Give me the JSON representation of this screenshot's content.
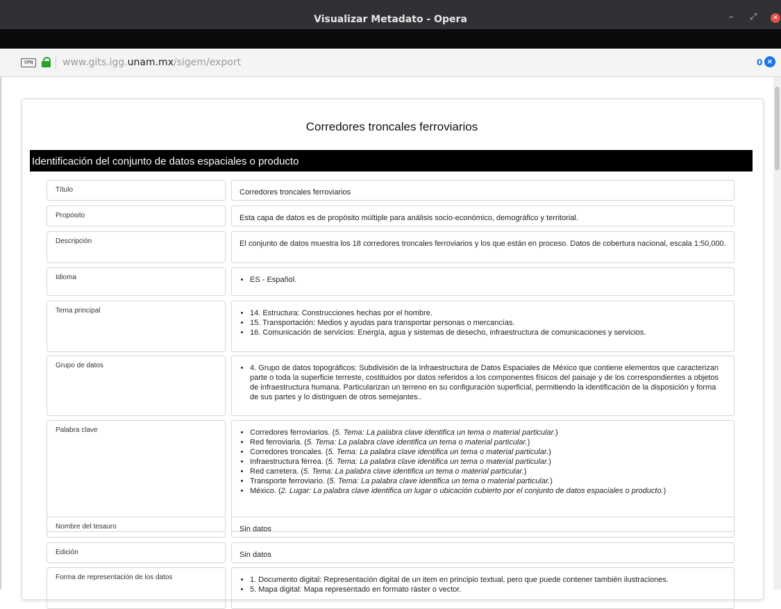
{
  "window": {
    "title": "Visualizar Metadato - Opera",
    "minimize": "–",
    "restore": "⤢",
    "close": "×"
  },
  "addressbar": {
    "vpn_label": "VPN",
    "url_prefix": "www.gits.igg.",
    "url_domain": "unam.mx",
    "url_path": "/sigem/export",
    "counter": "0",
    "badge_symbol": "×"
  },
  "document": {
    "title": "Corredores troncales ferroviarios",
    "section_title": "Identificación del conjunto de datos espaciales o producto",
    "rows": [
      {
        "label": "Título",
        "text": "Corredores troncales ferroviarios"
      },
      {
        "label": "Propósito",
        "text": "Esta capa de datos es de propósito múltiple para análisis socio-económico, demográfico y territorial."
      },
      {
        "label": "Descripción",
        "text": "El conjunto de datos muestra los 18 corredores troncales ferroviarios y los que están en proceso. Datos de cobertura nacional, escala 1:50,000."
      },
      {
        "label": "Idioma",
        "items": [
          "ES - Español."
        ]
      },
      {
        "label": "Tema principal",
        "items": [
          "14. Estructura: Construcciones hechas por el hombre.",
          "15. Transportación: Medios y ayudas para transportar personas o mercancías.",
          "16. Comunicación de servicios: Energía, agua y sistemas de desecho, infraestructura de comunicaciones y servicios."
        ]
      },
      {
        "label": "Grupo de datos",
        "items": [
          "4. Grupo de datos topográficos: Subdivisión de la Infraestructura de Datos Espaciales de México que contiene elementos que caracterizan parte o toda la superficie terreste, costituidos por datos referidos a los componentes físicos del paisaje y de los correspondientes a objetos de infraestructura humana. Particularizan un terreno en su configuración superficial, permitiendo la identificación de la disposición y forma de sus partes y lo distinguen de otros semejantes.."
        ]
      },
      {
        "label": "Palabra clave",
        "keywords": [
          {
            "term": "Corredores ferroviarios.",
            "note": "5. Tema: La palabra clave identifica un tema o material particular."
          },
          {
            "term": "Red ferroviaria.",
            "note": "5. Tema: La palabra clave identifica un tema o material particular."
          },
          {
            "term": "Corredores troncales.",
            "note": "5. Tema: La palabra clave identifica un tema o material particular."
          },
          {
            "term": "Infraestructura férrea.",
            "note": "5. Tema: La palabra clave identifica un tema o material particular."
          },
          {
            "term": "Red carretera.",
            "note": "5. Tema: La palabra clave identifica un tema o material particular."
          },
          {
            "term": "Transporte ferroviario.",
            "note": "5. Tema: La palabra clave identifica un tema o material particular."
          },
          {
            "term": "México.",
            "note": "2. Lugar: La palabra clave identifica un lugar o ubicación cubierto por el conjunto de datos espaciales o producto."
          }
        ]
      },
      {
        "label": "Nombre del tesauro",
        "text": "Sin datos"
      },
      {
        "label": "Edición",
        "text": "Sin datos"
      },
      {
        "label": "Forma de representación de los datos",
        "items": [
          "1. Documento digital: Representación digital de un item en principio textual, pero que puede contener también ilustraciones.",
          "5. Mapa digital: Mapa representado en formato ráster o vector."
        ]
      }
    ]
  },
  "colors": {
    "titlebar": "#2f3134",
    "section_header": "#000000",
    "lock_green": "#29a329",
    "badge_blue": "#1a73e8"
  }
}
